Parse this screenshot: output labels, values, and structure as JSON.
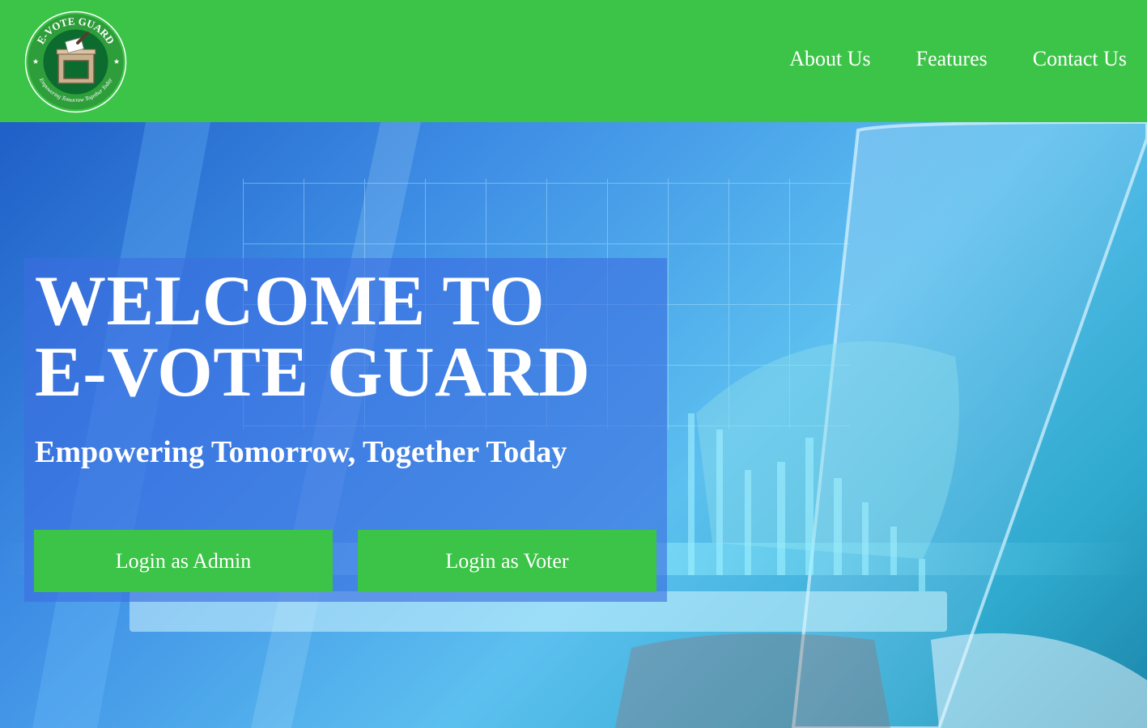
{
  "logo": {
    "top_text": "E-VOTE GUARD",
    "bottom_text": "Empowering Tomorrow Together Today"
  },
  "nav": {
    "items": [
      {
        "label": "About Us"
      },
      {
        "label": "Features"
      },
      {
        "label": "Contact Us"
      }
    ]
  },
  "hero": {
    "headline_line1": "WELCOME TO",
    "headline_line2": "E-VOTE GUARD",
    "tagline": "Empowering Tomorrow, Together Today",
    "buttons": {
      "admin_label": "Login as Admin",
      "voter_label": "Login as Voter"
    }
  },
  "colors": {
    "brand_green": "#3bc447",
    "logo_dark_green": "#0c6b2e",
    "panel_blue": "#3c6ee1",
    "text": "#ffffff"
  }
}
